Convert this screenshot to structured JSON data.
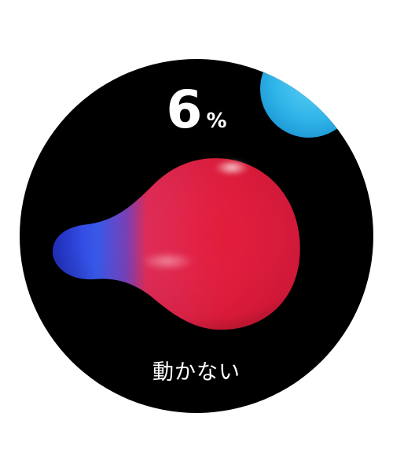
{
  "percent": {
    "value": "6",
    "unit": "%"
  },
  "status": {
    "label": "動かない"
  },
  "colors": {
    "background": "#000000",
    "blob_red": "#e51b3a",
    "blob_blue": "#2d46e6",
    "corner_orb": "#2fb4e8"
  }
}
